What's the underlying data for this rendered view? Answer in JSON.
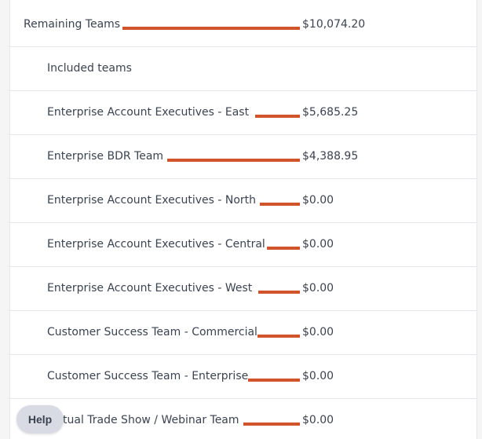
{
  "summary": {
    "label": "Remaining Teams",
    "value": "$10,074.20",
    "bar_fraction": 1.0
  },
  "section_label": "Included teams",
  "teams": [
    {
      "name": "Enterprise Account Executives - East",
      "value": "$5,685.25",
      "bar_fraction": 0.564
    },
    {
      "name": "Enterprise BDR Team",
      "value": "$4,388.95",
      "bar_fraction": 0.436
    },
    {
      "name": "Enterprise Account Executives - North",
      "value": "$0.00",
      "bar_fraction": 0
    },
    {
      "name": "Enterprise Account Executives - Central",
      "value": "$0.00",
      "bar_fraction": 0
    },
    {
      "name": "Enterprise Account Executives - West",
      "value": "$0.00",
      "bar_fraction": 0
    },
    {
      "name": "Customer Success Team - Commercial",
      "value": "$0.00",
      "bar_fraction": 0
    },
    {
      "name": "Customer Success Team - Enterprise",
      "value": "$0.00",
      "bar_fraction": 0
    },
    {
      "name": "tual Trade Show / Webinar Team",
      "value": "$0.00",
      "bar_fraction": 0
    }
  ],
  "help_button": {
    "label": "Help"
  },
  "colors": {
    "bar": "#d0532b",
    "text": "#3b4350",
    "divider": "#e3e4e8"
  }
}
